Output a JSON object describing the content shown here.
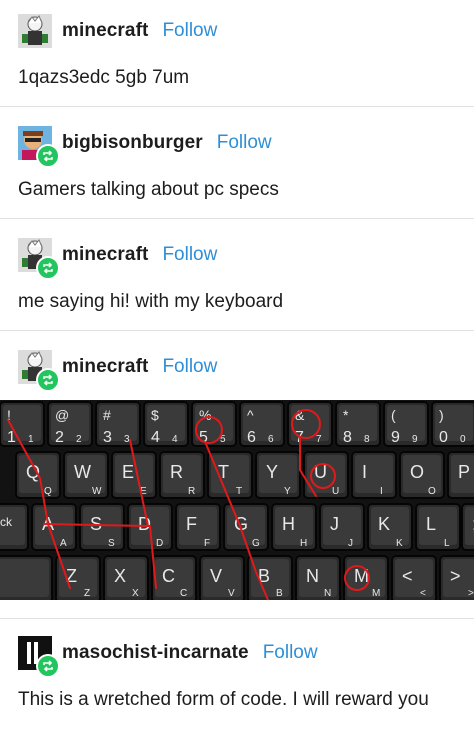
{
  "posts": [
    {
      "username": "minecraft",
      "follow": "Follow",
      "text": "1qazs3edc 5gb 7um",
      "reblogged": false
    },
    {
      "username": "bigbisonburger",
      "follow": "Follow",
      "text": "Gamers talking about pc specs",
      "reblogged": true
    },
    {
      "username": "minecraft",
      "follow": "Follow",
      "text": "me saying hi! with my keyboard",
      "reblogged": true
    },
    {
      "username": "minecraft",
      "follow": "Follow",
      "text": "",
      "reblogged": true
    },
    {
      "username": "masochist-incarnate",
      "follow": "Follow",
      "text": "This is a wretched form of code. I will reward you",
      "reblogged": true
    }
  ],
  "keyboard": {
    "row1": [
      {
        "top": "!",
        "bottom": "1",
        "sub": "1"
      },
      {
        "top": "@",
        "bottom": "2",
        "sub": "2"
      },
      {
        "top": "#",
        "bottom": "3",
        "sub": "3"
      },
      {
        "top": "$",
        "bottom": "4",
        "sub": "4"
      },
      {
        "top": "%",
        "bottom": "5",
        "sub": "5"
      },
      {
        "top": "^",
        "bottom": "6",
        "sub": "6"
      },
      {
        "top": "&",
        "bottom": "7",
        "sub": "7"
      },
      {
        "top": "*",
        "bottom": "8",
        "sub": "8"
      },
      {
        "top": "(",
        "bottom": "9",
        "sub": "9"
      },
      {
        "top": ")",
        "bottom": "0",
        "sub": "0"
      }
    ],
    "row2": [
      "Q",
      "W",
      "E",
      "R",
      "T",
      "Y",
      "U",
      "I",
      "O",
      "P"
    ],
    "row3": [
      "A",
      "S",
      "D",
      "F",
      "G",
      "H",
      "J",
      "K",
      "L",
      ";"
    ],
    "row4": [
      "Z",
      "X",
      "C",
      "V",
      "B",
      "N",
      "M",
      "<",
      " >"
    ],
    "row3_left_partial": "ck"
  },
  "colors": {
    "follow": "#2f8fd6",
    "reblog_badge": "#22c55e",
    "annotation": "#e0191b"
  }
}
